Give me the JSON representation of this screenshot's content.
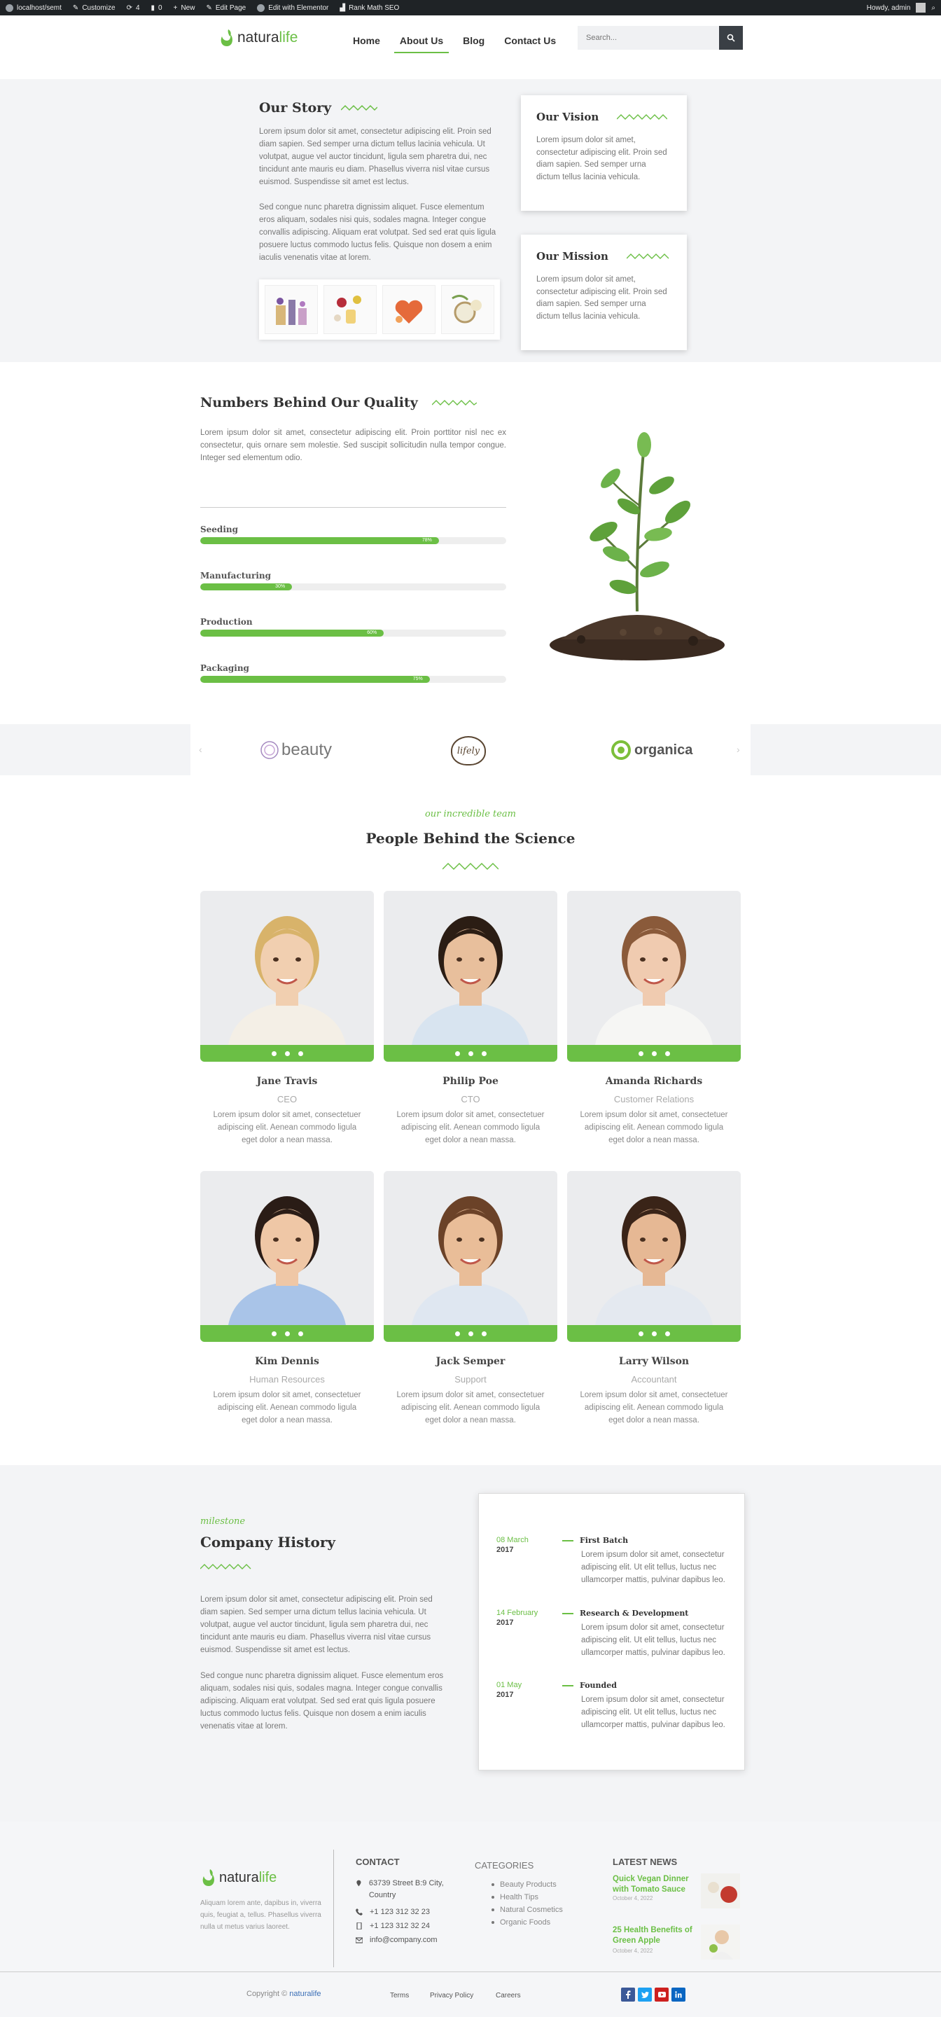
{
  "admin_bar": {
    "items": [
      "localhost/semt",
      "Customize",
      "4",
      "0",
      "New",
      "Edit Page",
      "Edit with Elementor",
      "Rank Math SEO"
    ],
    "greeting": "Howdy, admin"
  },
  "header": {
    "logo_part1": "natura",
    "logo_part2": "life",
    "nav": [
      "Home",
      "About Us",
      "Blog",
      "Contact Us"
    ],
    "active_nav": "About Us",
    "search_placeholder": "Search..."
  },
  "story": {
    "title": "Our Story",
    "p1": "Lorem ipsum dolor sit amet, consectetur adipiscing elit. Proin sed diam sapien. Sed semper urna dictum tellus lacinia vehicula. Ut volutpat, augue vel auctor tincidunt, ligula sem pharetra dui, nec tincidunt ante mauris eu diam. Phasellus viverra nisl vitae cursus euismod. Suspendisse sit amet est lectus.",
    "p2": "Sed congue nunc pharetra dignissim aliquet. Fusce elementum eros aliquam, sodales nisi quis, sodales magna. Integer congue convallis adipiscing. Aliquam erat volutpat. Sed sed erat quis ligula posuere luctus commodo luctus felis. Quisque non dosem a enim iaculis venenatis vitae at lorem."
  },
  "vision": {
    "title": "Our Vision",
    "text": "Lorem ipsum dolor sit amet, consectetur adipiscing elit. Proin sed diam sapien. Sed semper urna dictum tellus lacinia vehicula."
  },
  "mission": {
    "title": "Our Mission",
    "text": "Lorem ipsum dolor sit amet, consectetur adipiscing elit. Proin sed diam sapien. Sed semper urna dictum tellus lacinia vehicula."
  },
  "numbers": {
    "title": "Numbers Behind Our Quality",
    "intro": "Lorem ipsum dolor sit amet, consectetur adipiscing elit. Proin porttitor nisl nec ex consectetur, quis ornare sem molestie. Sed suscipit sollicitudin nulla tempor congue. Integer sed elementum odio.",
    "bars": [
      {
        "label": "Seeding",
        "value": 78,
        "pct_label": "78%"
      },
      {
        "label": "Manufacturing",
        "value": 30,
        "pct_label": "30%"
      },
      {
        "label": "Production",
        "value": 60,
        "pct_label": "60%"
      },
      {
        "label": "Packaging",
        "value": 75,
        "pct_label": "75%"
      }
    ]
  },
  "partners": [
    "beauty",
    "lifely",
    "organica"
  ],
  "team": {
    "kicker": "our incredible team",
    "heading": "People Behind the Science",
    "members": [
      {
        "name": "Jane Travis",
        "role": "CEO",
        "bio": "Lorem ipsum dolor sit amet, consectetuer adipiscing elit. Aenean commodo ligula eget dolor a nean massa."
      },
      {
        "name": "Philip Poe",
        "role": "CTO",
        "bio": "Lorem ipsum dolor sit amet, consectetuer adipiscing elit. Aenean commodo ligula eget dolor a nean massa."
      },
      {
        "name": "Amanda Richards",
        "role": "Customer Relations",
        "bio": "Lorem ipsum dolor sit amet, consectetuer adipiscing elit. Aenean commodo ligula eget dolor a nean massa."
      },
      {
        "name": "Kim Dennis",
        "role": "Human Resources",
        "bio": "Lorem ipsum dolor sit amet, consectetuer adipiscing elit. Aenean commodo ligula eget dolor a nean massa."
      },
      {
        "name": "Jack Semper",
        "role": "Support",
        "bio": "Lorem ipsum dolor sit amet, consectetuer adipiscing elit. Aenean commodo ligula eget dolor a nean massa."
      },
      {
        "name": "Larry Wilson",
        "role": "Accountant",
        "bio": "Lorem ipsum dolor sit amet, consectetuer adipiscing elit. Aenean commodo ligula eget dolor a nean massa."
      }
    ]
  },
  "history": {
    "kicker": "milestone",
    "heading": "Company History",
    "p1": "Lorem ipsum dolor sit amet, consectetur adipiscing elit. Proin sed diam sapien. Sed semper urna dictum tellus lacinia vehicula. Ut volutpat, augue vel auctor tincidunt, ligula sem pharetra dui, nec tincidunt ante mauris eu diam. Phasellus viverra nisl vitae cursus euismod. Suspendisse sit amet est lectus.",
    "p2": "Sed congue nunc pharetra dignissim aliquet. Fusce elementum eros aliquam, sodales nisi quis, sodales magna. Integer congue convallis adipiscing. Aliquam erat volutpat. Sed sed erat quis ligula posuere luctus commodo luctus felis. Quisque non dosem a enim iaculis venenatis vitae at lorem.",
    "timeline": [
      {
        "date": "08 March",
        "year": "2017",
        "title": "First Batch",
        "text": "Lorem ipsum dolor sit amet, consectetur adipiscing elit. Ut elit tellus, luctus nec ullamcorper mattis, pulvinar dapibus leo."
      },
      {
        "date": "14 February",
        "year": "2017",
        "title": "Research & Development",
        "text": "Lorem ipsum dolor sit amet, consectetur adipiscing elit. Ut elit tellus, luctus nec ullamcorper mattis, pulvinar dapibus leo."
      },
      {
        "date": "01 May",
        "year": "2017",
        "title": "Founded",
        "text": "Lorem ipsum dolor sit amet, consectetur adipiscing elit. Ut elit tellus, luctus nec ullamcorper mattis, pulvinar dapibus leo."
      }
    ]
  },
  "footer": {
    "logo_part1": "natura",
    "logo_part2": "life",
    "desc": "Aliquam lorem ante, dapibus in, viverra quis, feugiat a, tellus. Phasellus viverra nulla ut metus varius laoreet.",
    "contact_title": "CONTACT",
    "address": "63739 Street B:9 City, Country",
    "phone1": "+1 123 312 32 23",
    "phone2": "+1 123 312 32 24",
    "email": "info@company.com",
    "categories_title": "CATEGORIES",
    "categories": [
      "Beauty Products",
      "Health Tips",
      "Natural Cosmetics",
      "Organic Foods"
    ],
    "news_title": "LATEST NEWS",
    "news": [
      {
        "title": "Quick Vegan Dinner with Tomato Sauce",
        "date": "October 4, 2022"
      },
      {
        "title": "25 Health Benefits of Green Apple",
        "date": "October 4, 2022"
      }
    ],
    "copyright": "Copyright © ",
    "copyright_brand": "naturalife",
    "links": [
      "Terms",
      "Privacy Policy",
      "Careers"
    ]
  },
  "colors": {
    "accent": "#6bbf45",
    "dark": "#333333",
    "admin_bar": "#1f2326"
  }
}
